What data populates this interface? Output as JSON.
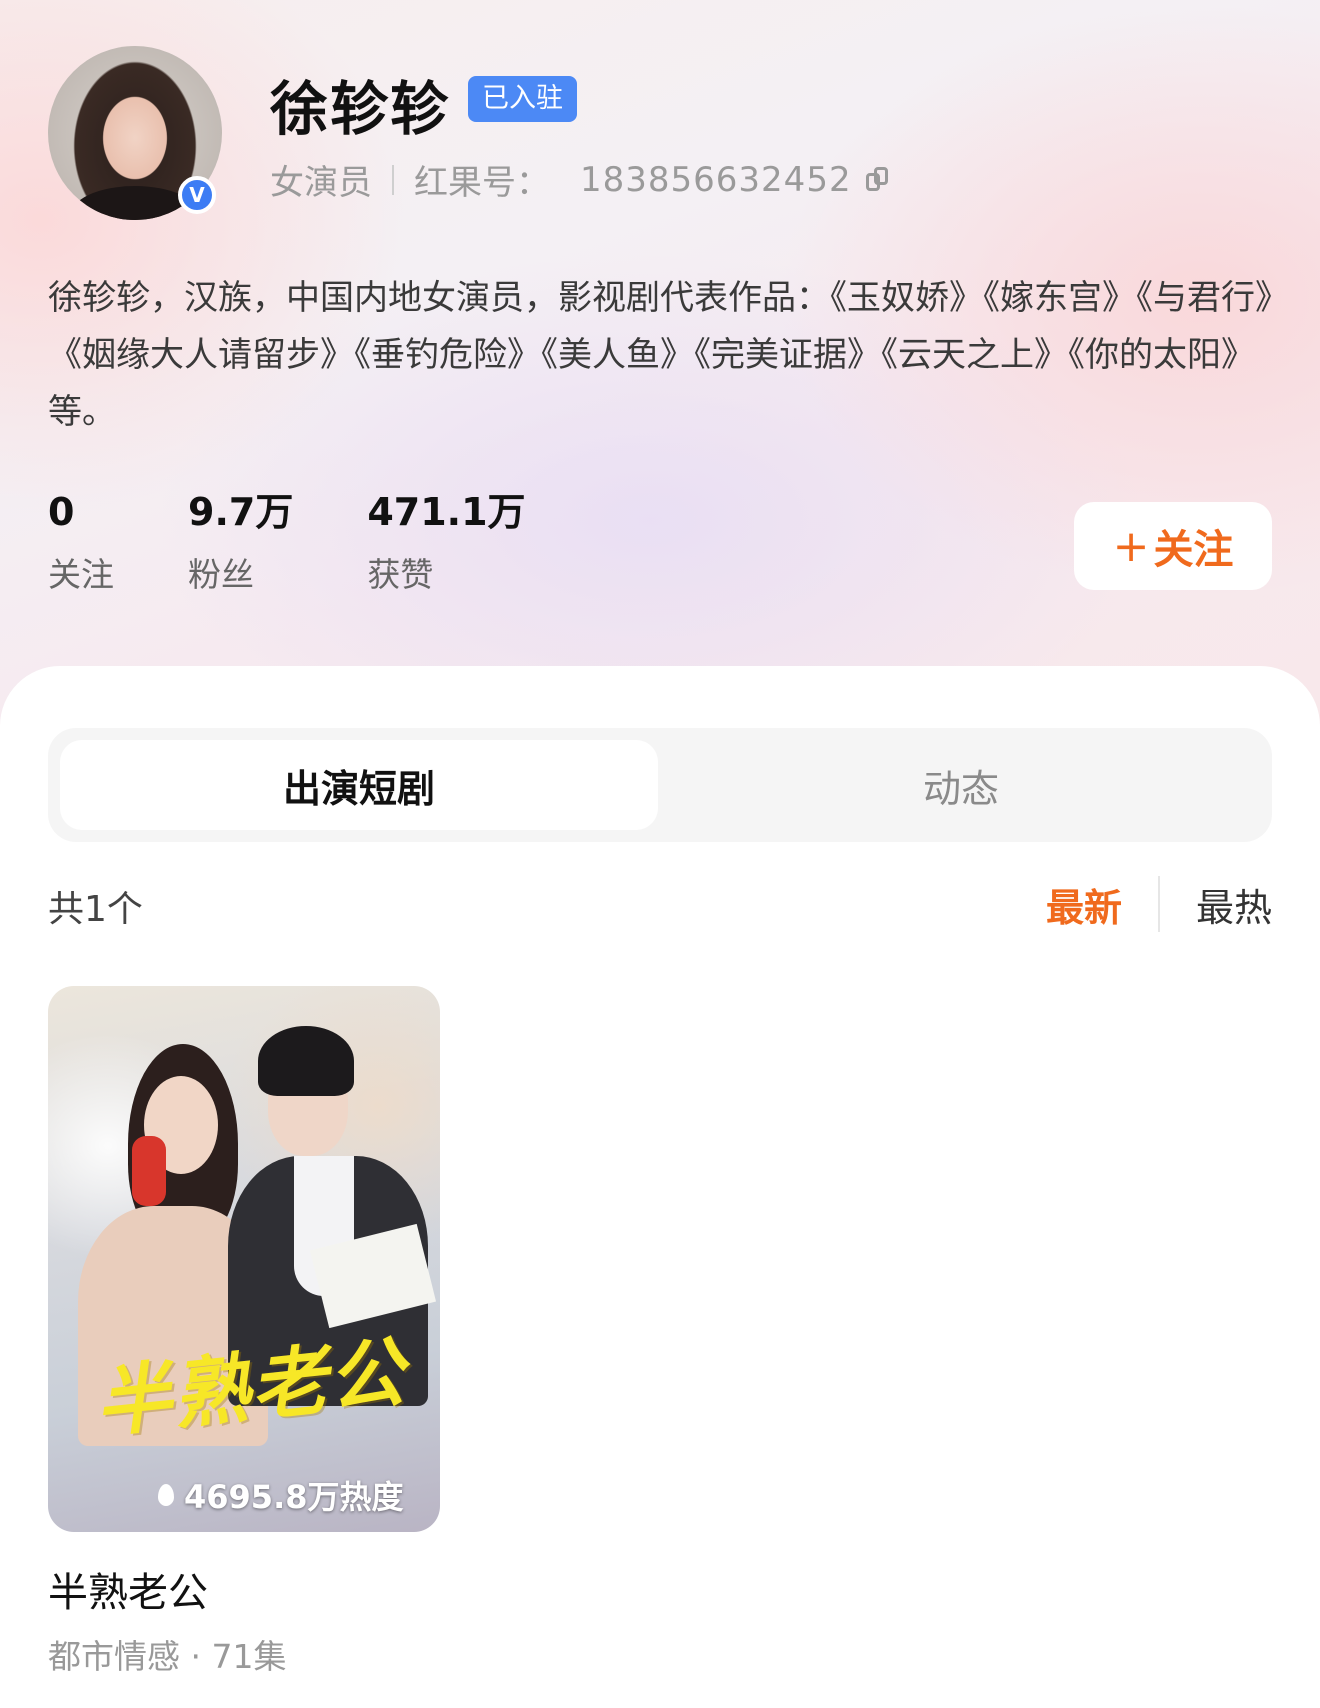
{
  "profile": {
    "name": "徐轸轸",
    "verified_tag": "已入驻",
    "role": "女演员",
    "id_label": "红果号：",
    "id_value": "183856632452",
    "bio": "徐轸轸，汉族，中国内地女演员，影视剧代表作品：《玉奴娇》《嫁东宫》《与君行》《姻缘大人请留步》《垂钓危险》《美人鱼》《完美证据》《云天之上》《你的太阳》等。",
    "verified_badge": "V"
  },
  "stats": [
    {
      "value": "0",
      "label": "关注"
    },
    {
      "value": "9.7万",
      "label": "粉丝"
    },
    {
      "value": "471.1万",
      "label": "获赞"
    }
  ],
  "follow_button": {
    "icon": "+",
    "label": "关注"
  },
  "tabs": [
    {
      "label": "出演短剧",
      "active": true
    },
    {
      "label": "动态",
      "active": false
    }
  ],
  "list": {
    "count": "共1个",
    "sort_latest": "最新",
    "sort_hottest": "最热"
  },
  "drama": {
    "poster_title": "半熟老公",
    "heat": "4695.8万热度",
    "title": "半熟老公",
    "subtitle": "都市情感 · 71集"
  },
  "colors": {
    "accent": "#f06a1d",
    "verified_blue": "#4c89f5"
  }
}
